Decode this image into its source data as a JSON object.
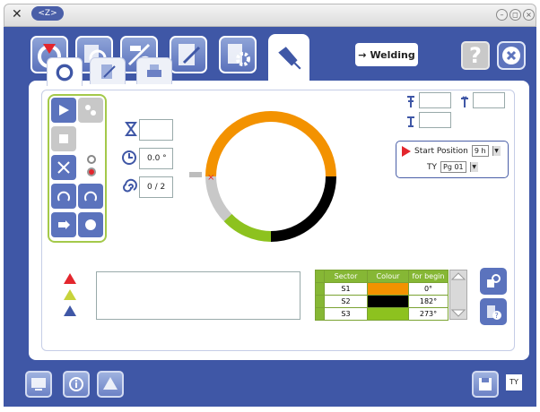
{
  "window": {
    "title_tab": "<Z>",
    "controls": [
      "min-icon",
      "restore-icon",
      "close-icon"
    ]
  },
  "toolbar": {
    "buttons": [
      "weld-program-icon",
      "cycle-icon",
      "tool-setup-icon",
      "edit-icon",
      "settings-icon",
      "welding-torch-icon"
    ],
    "mode_label": "Welding",
    "mode_prefix": "→",
    "help_label": "?"
  },
  "subtabs": [
    "cycle-icon",
    "edit-sheet-icon",
    "printer-icon"
  ],
  "fields": {
    "timer_value": "",
    "angle_value": "0.0 °",
    "pass_value": "0 / 2",
    "top_right_a": "",
    "top_right_b": "",
    "top_right_c": ""
  },
  "start": {
    "label": "Start Position",
    "position_value": "9 h",
    "ty_label": "TY",
    "program_value": "Pg 01"
  },
  "sectors": {
    "headers": [
      "Sector",
      "Colour",
      "for begin"
    ],
    "rows": [
      {
        "name": "S1",
        "color": "#f39200",
        "begin": "0°"
      },
      {
        "name": "S2",
        "color": "#000000",
        "begin": "182°"
      },
      {
        "name": "S3",
        "color": "#8dc21f",
        "begin": "273°"
      }
    ]
  },
  "colors": {
    "accent": "#3f57a6",
    "green": "#a4c94a",
    "orange": "#f39200",
    "black": "#000000",
    "lime": "#8dc21f",
    "grey": "#c8c8c8"
  },
  "bottom": {
    "ty_label": "TY"
  }
}
